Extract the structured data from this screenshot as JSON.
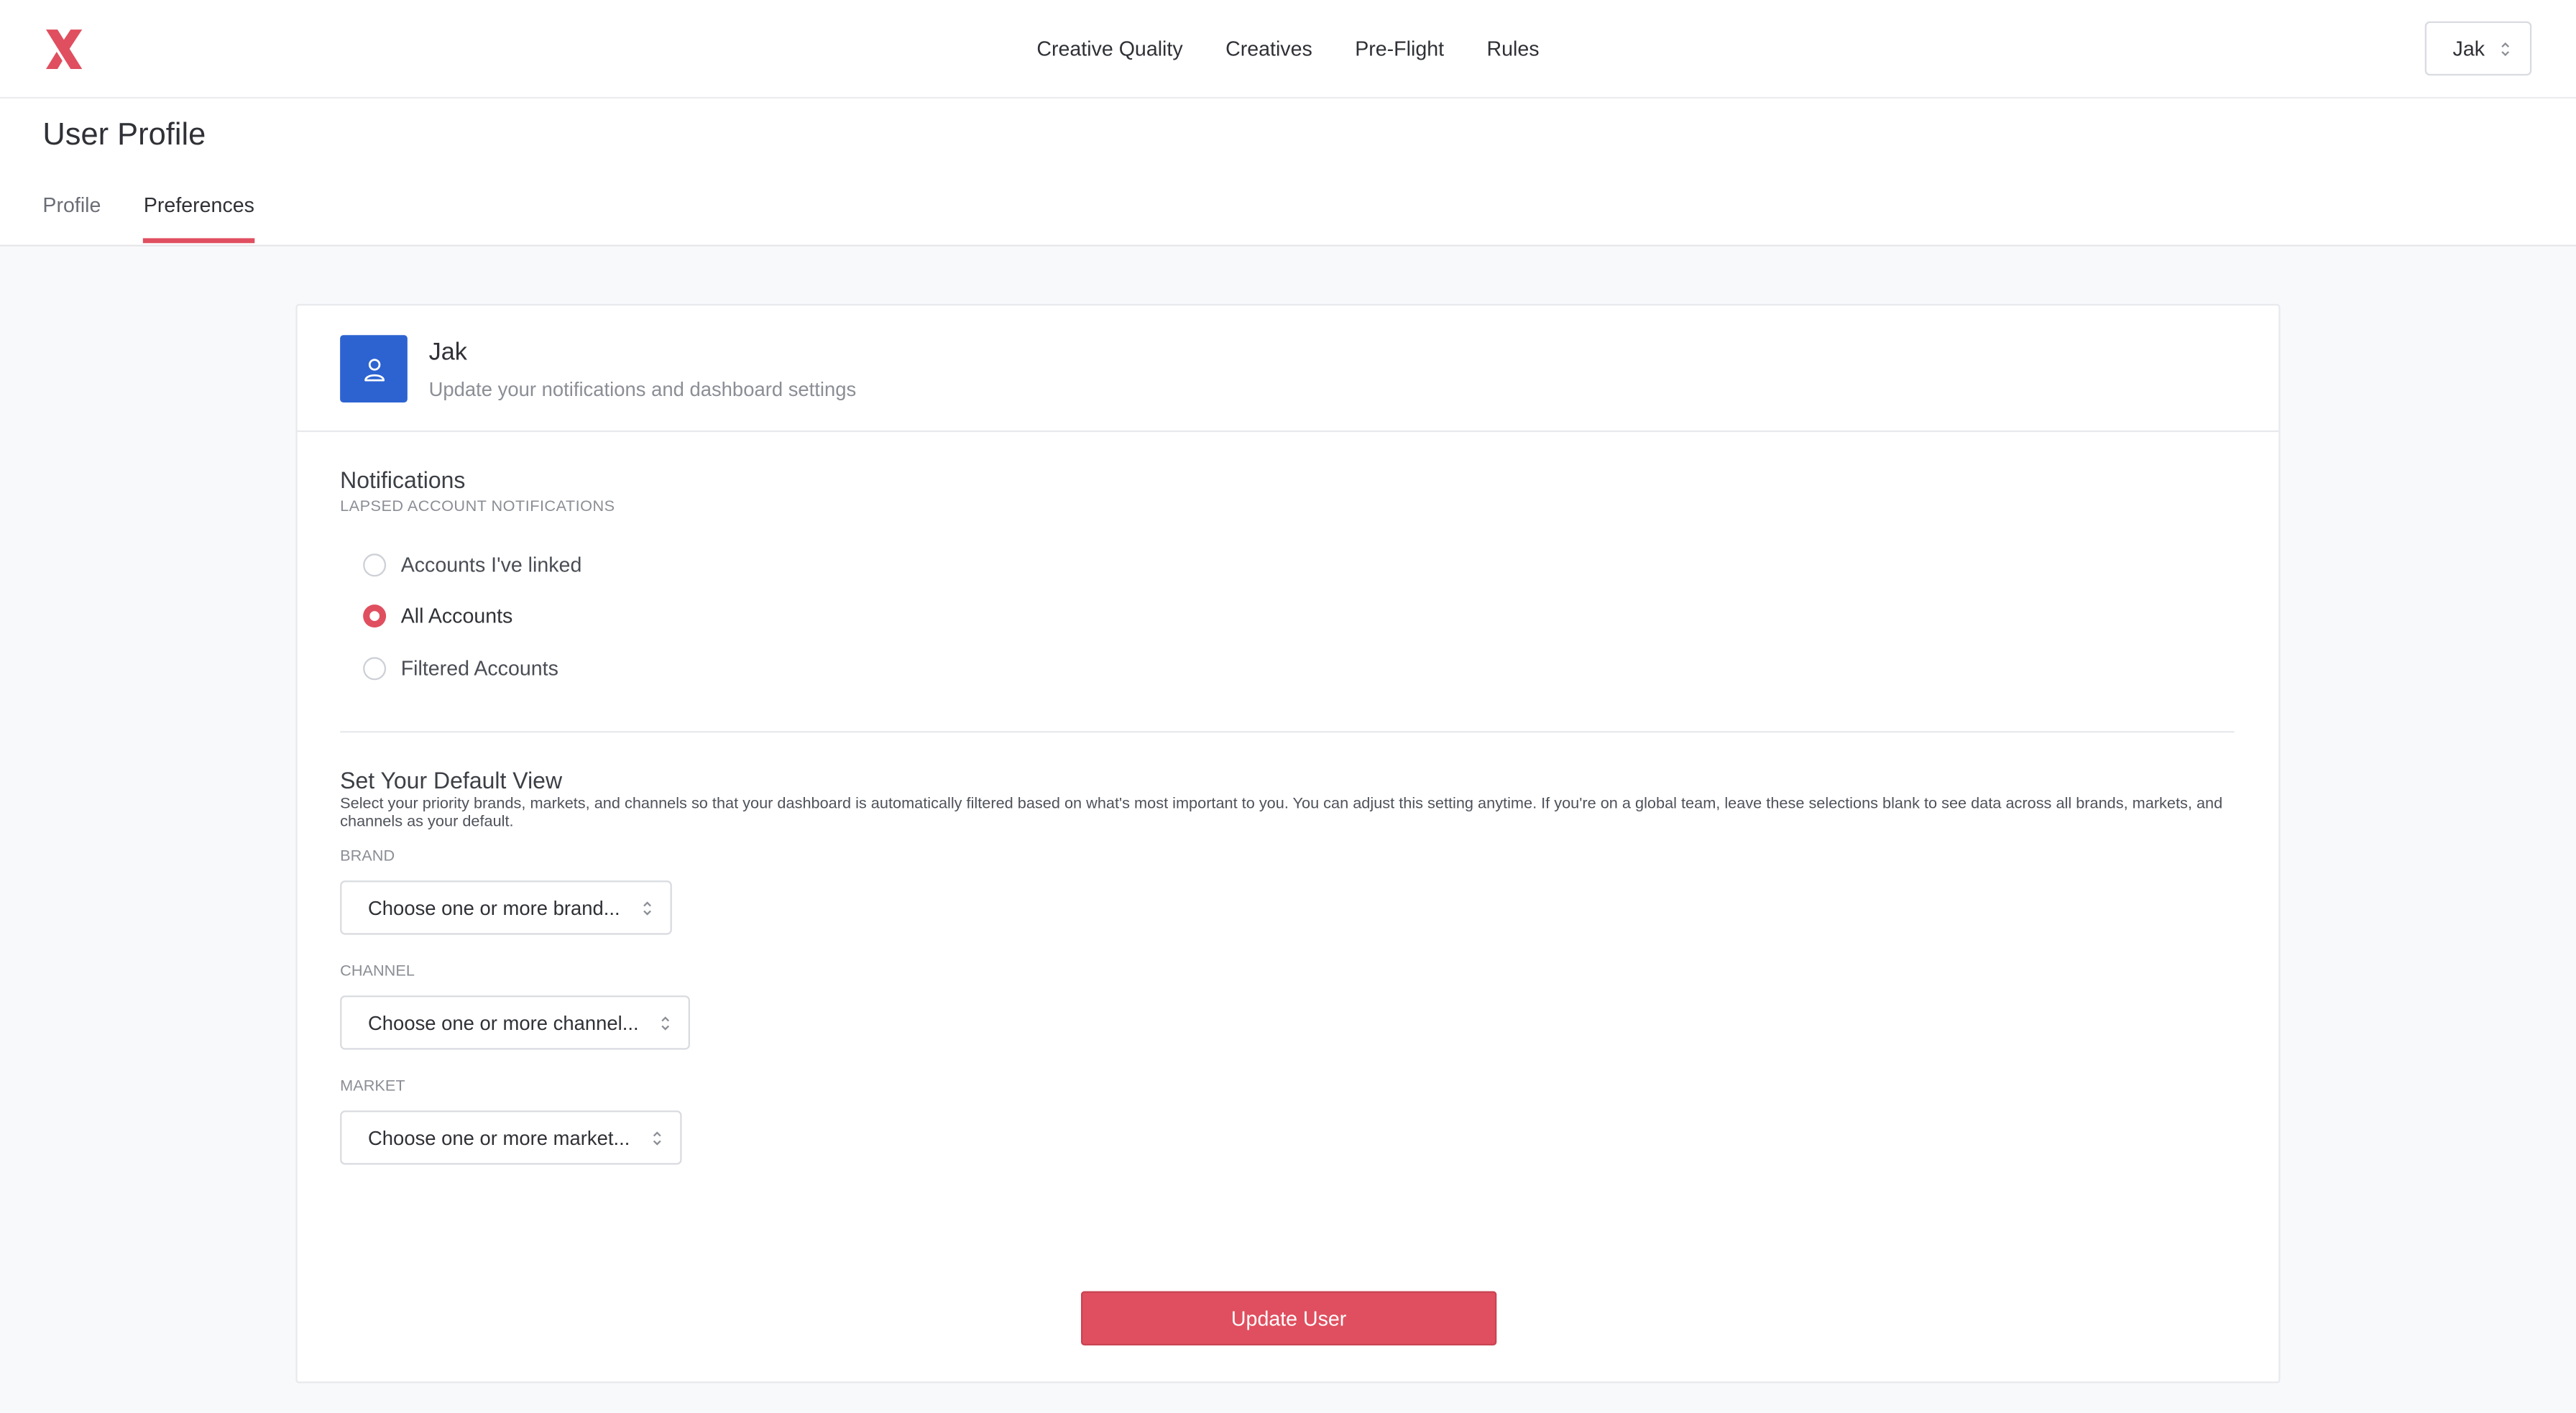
{
  "app": {
    "logo_icon": "brand-x-logo-icon",
    "accent_color": "#e04f5f",
    "avatar_color": "#2d63d1"
  },
  "nav": {
    "items": [
      {
        "label": "Creative Quality"
      },
      {
        "label": "Creatives"
      },
      {
        "label": "Pre-Flight"
      },
      {
        "label": "Rules"
      }
    ],
    "user_select_value": "Jak"
  },
  "page": {
    "title": "User Profile",
    "tabs": [
      {
        "label": "Profile",
        "active": false
      },
      {
        "label": "Preferences",
        "active": true
      }
    ]
  },
  "card": {
    "name": "Jak",
    "subtitle": "Update your notifications and dashboard settings",
    "avatar_icon": "user-icon"
  },
  "notifications": {
    "title": "Notifications",
    "caption": "LAPSED ACCOUNT NOTIFICATIONS",
    "options": [
      {
        "label": "Accounts I've linked",
        "checked": false
      },
      {
        "label": "All Accounts",
        "checked": true
      },
      {
        "label": "Filtered Accounts",
        "checked": false
      }
    ]
  },
  "default_view": {
    "title": "Set Your Default View",
    "description": "Select your priority brands, markets, and channels so that your dashboard is automatically filtered based on what's most important to you. You can adjust this setting anytime. If you're on a global team, leave these selections blank to see data across all brands, markets, and channels as your default.",
    "brand": {
      "label": "BRAND",
      "placeholder": "Choose one or more brand..."
    },
    "channel": {
      "label": "CHANNEL",
      "placeholder": "Choose one or more channel..."
    },
    "market": {
      "label": "MARKET",
      "placeholder": "Choose one or more market..."
    }
  },
  "actions": {
    "update_label": "Update User"
  }
}
